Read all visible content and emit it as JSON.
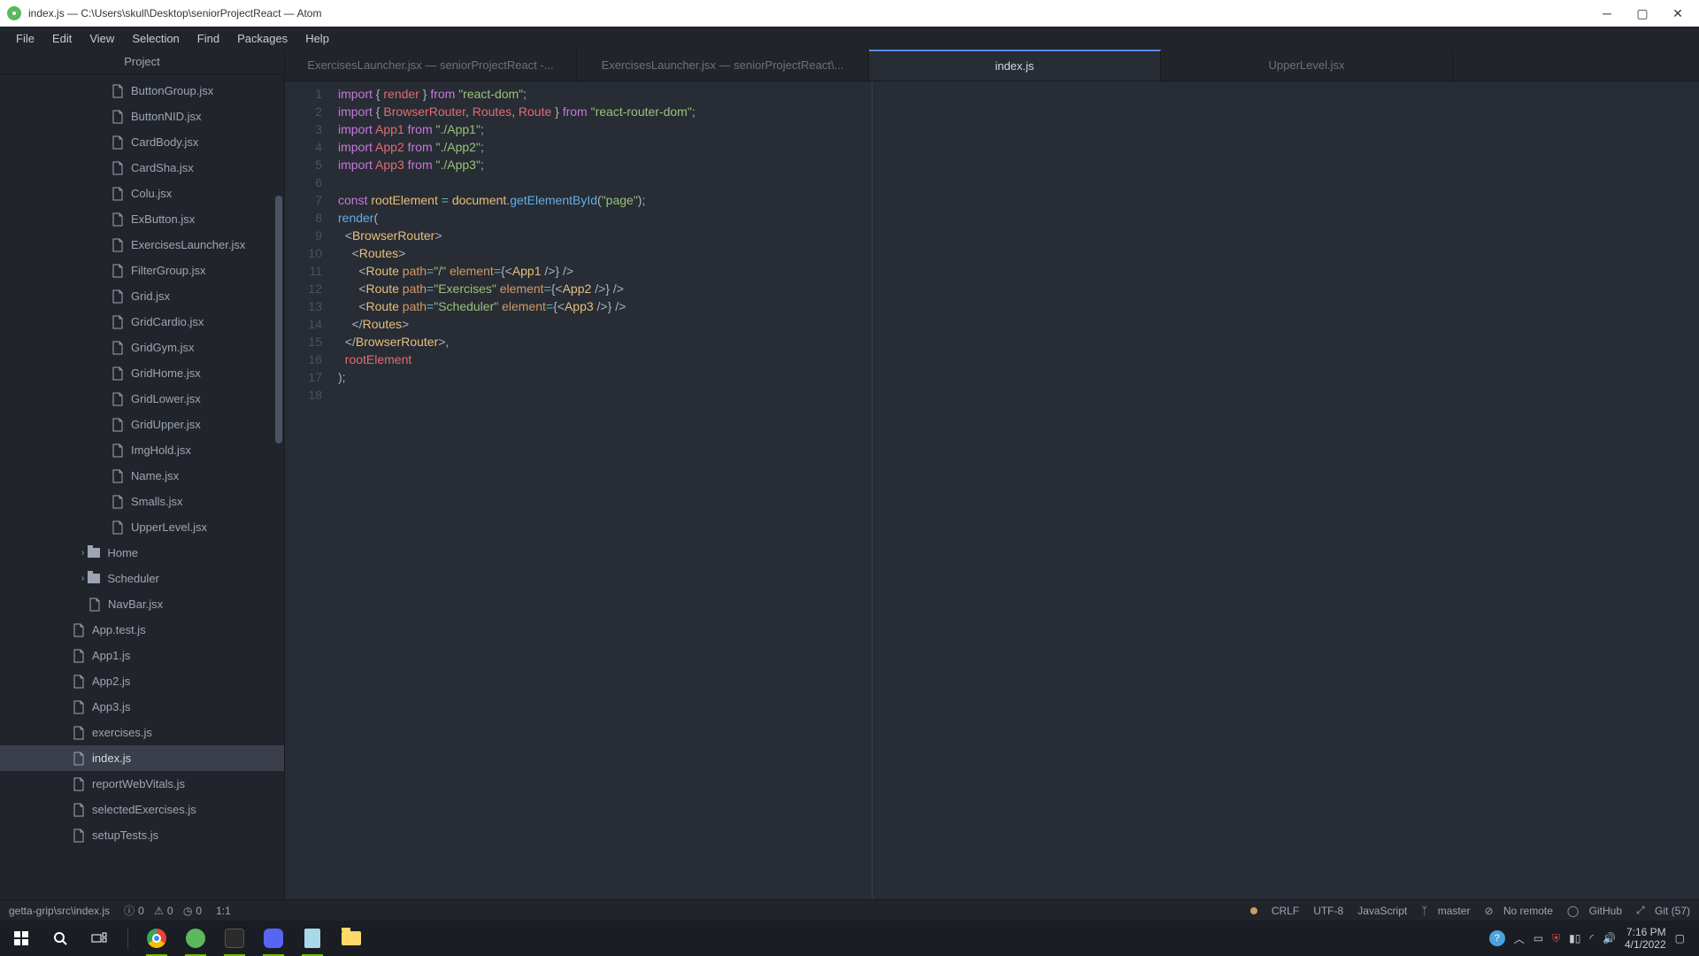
{
  "titlebar": {
    "title": "index.js — C:\\Users\\skull\\Desktop\\seniorProjectReact — Atom"
  },
  "menu": [
    "File",
    "Edit",
    "View",
    "Selection",
    "Find",
    "Packages",
    "Help"
  ],
  "sidebar": {
    "header": "Project",
    "items": [
      {
        "name": "ButtonGroup.jsx",
        "depth": 2,
        "type": "file"
      },
      {
        "name": "ButtonNID.jsx",
        "depth": 2,
        "type": "file"
      },
      {
        "name": "CardBody.jsx",
        "depth": 2,
        "type": "file"
      },
      {
        "name": "CardSha.jsx",
        "depth": 2,
        "type": "file"
      },
      {
        "name": "Colu.jsx",
        "depth": 2,
        "type": "file"
      },
      {
        "name": "ExButton.jsx",
        "depth": 2,
        "type": "file"
      },
      {
        "name": "ExercisesLauncher.jsx",
        "depth": 2,
        "type": "file"
      },
      {
        "name": "FilterGroup.jsx",
        "depth": 2,
        "type": "file"
      },
      {
        "name": "Grid.jsx",
        "depth": 2,
        "type": "file"
      },
      {
        "name": "GridCardio.jsx",
        "depth": 2,
        "type": "file"
      },
      {
        "name": "GridGym.jsx",
        "depth": 2,
        "type": "file"
      },
      {
        "name": "GridHome.jsx",
        "depth": 2,
        "type": "file"
      },
      {
        "name": "GridLower.jsx",
        "depth": 2,
        "type": "file"
      },
      {
        "name": "GridUpper.jsx",
        "depth": 2,
        "type": "file"
      },
      {
        "name": "ImgHold.jsx",
        "depth": 2,
        "type": "file"
      },
      {
        "name": "Name.jsx",
        "depth": 2,
        "type": "file"
      },
      {
        "name": "Smalls.jsx",
        "depth": 2,
        "type": "file"
      },
      {
        "name": "UpperLevel.jsx",
        "depth": 2,
        "type": "file"
      },
      {
        "name": "Home",
        "depth": 1,
        "type": "folder"
      },
      {
        "name": "Scheduler",
        "depth": 1,
        "type": "folder"
      },
      {
        "name": "NavBar.jsx",
        "depth": 1,
        "type": "file-indent"
      },
      {
        "name": "App.test.js",
        "depth": 0,
        "type": "file"
      },
      {
        "name": "App1.js",
        "depth": 0,
        "type": "file"
      },
      {
        "name": "App2.js",
        "depth": 0,
        "type": "file"
      },
      {
        "name": "App3.js",
        "depth": 0,
        "type": "file"
      },
      {
        "name": "exercises.js",
        "depth": 0,
        "type": "file"
      },
      {
        "name": "index.js",
        "depth": 0,
        "type": "file",
        "selected": true
      },
      {
        "name": "reportWebVitals.js",
        "depth": 0,
        "type": "file"
      },
      {
        "name": "selectedExercises.js",
        "depth": 0,
        "type": "file"
      },
      {
        "name": "setupTests.js",
        "depth": 0,
        "type": "file"
      }
    ]
  },
  "tabs": [
    {
      "label": "ExercisesLauncher.jsx — seniorProjectReact -...",
      "active": false
    },
    {
      "label": "ExercisesLauncher.jsx — seniorProjectReact\\...",
      "active": false
    },
    {
      "label": "index.js",
      "active": true
    },
    {
      "label": "UpperLevel.jsx",
      "active": false
    }
  ],
  "code_lines": 18,
  "status": {
    "path": "getta-grip\\src\\index.js",
    "diag1": "0",
    "diag2": "0",
    "diag3": "0",
    "cursor": "1:1",
    "line_ending": "CRLF",
    "encoding": "UTF-8",
    "language": "JavaScript",
    "branch": "master",
    "remote": "No remote",
    "github": "GitHub",
    "git": "Git (57)"
  },
  "clock": {
    "time": "7:16 PM",
    "date": "4/1/2022"
  }
}
